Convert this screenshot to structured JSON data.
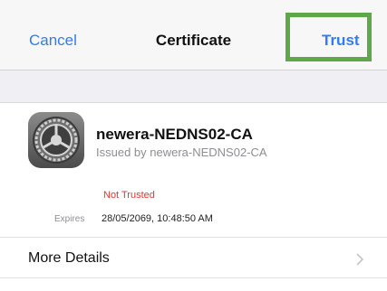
{
  "navbar": {
    "cancel_label": "Cancel",
    "title": "Certificate",
    "trust_label": "Trust"
  },
  "certificate": {
    "icon": "settings-gear-icon",
    "name": "newera-NEDNS02-CA",
    "issuer": "Issued by newera-NEDNS02-CA",
    "status": "Not Trusted",
    "expires_label": "Expires",
    "expires_value": "28/05/2069, 10:48:50 AM"
  },
  "details": {
    "more_label": "More Details"
  },
  "colors": {
    "accent": "#2f7cf6",
    "status_untrusted": "#e8332f",
    "highlight": "#5ea84a"
  }
}
